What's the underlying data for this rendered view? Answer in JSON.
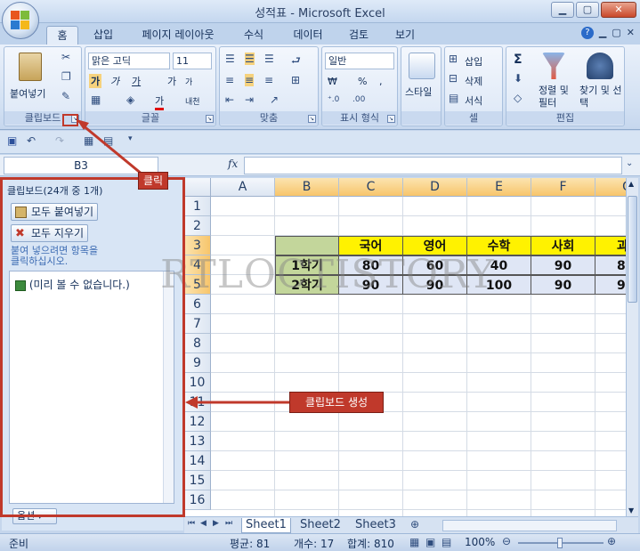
{
  "window": {
    "title": "성적표 - Microsoft Excel"
  },
  "tabs": [
    "홈",
    "삽입",
    "페이지 레이아웃",
    "수식",
    "데이터",
    "검토",
    "보기"
  ],
  "ribbon": {
    "clipboard": {
      "paste": "붙여넣기",
      "label": "클립보드"
    },
    "font": {
      "name": "맑은 고딕",
      "size": "11",
      "label": "글꼴",
      "bold": "가",
      "italic": "가",
      "underline": "가",
      "grow": "가",
      "shrink": "가",
      "color_glyph": "가",
      "phonetic": "내천"
    },
    "alignment": {
      "label": "맞춤"
    },
    "number": {
      "format": "일반",
      "currency": "₩",
      "percent": "%",
      "comma": ",",
      "label": "표시 형식"
    },
    "styles": {
      "button": "스타일"
    },
    "cells": {
      "insert": "삽입",
      "delete": "삭제",
      "format": "서식",
      "label": "셀"
    },
    "editing": {
      "sort": "정렬 및 필터",
      "find": "찾기 및 선택",
      "label": "편집",
      "sigma": "Σ"
    }
  },
  "formula_bar": {
    "name_box": "B3",
    "fx": "fx",
    "content": ""
  },
  "clipboard_pane": {
    "title": "클립보드(24개 중 1개)",
    "paste_all": "모두 붙여넣기",
    "clear_all": "모두 지우기",
    "note_line1": "붙여 넣으려면 항목을",
    "note_line2": "클릭하십시오.",
    "item": "(미리 볼 수 없습니다.)",
    "options": "옵션"
  },
  "sheet": {
    "columns": [
      "A",
      "B",
      "C",
      "D",
      "E",
      "F",
      "G"
    ],
    "rows": [
      "1",
      "2",
      "3",
      "4",
      "5",
      "6",
      "7",
      "8",
      "9",
      "10",
      "11",
      "12",
      "13",
      "14",
      "15",
      "16"
    ],
    "header_row": [
      "",
      "국어",
      "영어",
      "수학",
      "사회",
      "과"
    ],
    "data_rows": [
      {
        "label": "1학기",
        "values": [
          "80",
          "60",
          "40",
          "90",
          "8"
        ]
      },
      {
        "label": "2학기",
        "values": [
          "90",
          "90",
          "100",
          "90",
          "9"
        ]
      }
    ]
  },
  "sheet_tabs": [
    "Sheet1",
    "Sheet2",
    "Sheet3"
  ],
  "status": {
    "ready": "준비",
    "average": "평균: 81",
    "count": "개수: 17",
    "sum": "합계: 810",
    "zoom": "100%"
  },
  "annotations": {
    "click": "클릭",
    "created": "클립보드 생성"
  },
  "watermark": "RTLOCTISTORY",
  "colors": {
    "accent_red": "#c0392b",
    "header_yellow": "#fff200",
    "label_green": "#c3d69b",
    "data_blue": "#dfe6f5"
  }
}
